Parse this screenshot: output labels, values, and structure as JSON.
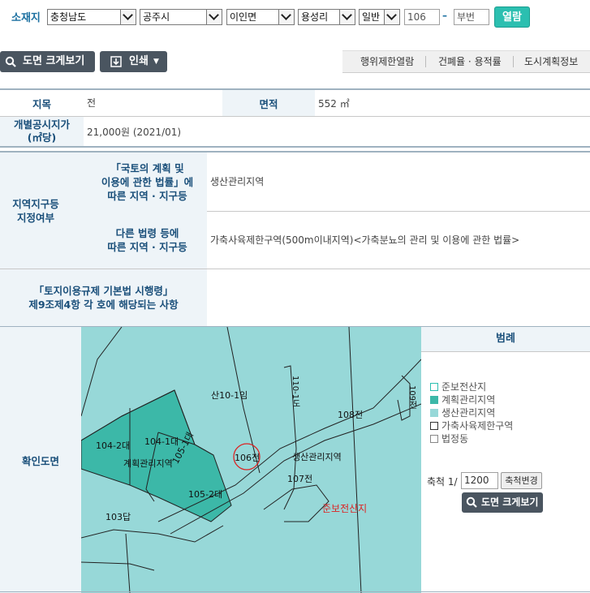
{
  "search": {
    "location_label": "소재지",
    "province": "충청남도",
    "city": "공주시",
    "town": "이인면",
    "village": "용성리",
    "land_type": "일반",
    "main_number": "106",
    "sub_placeholder": "부번",
    "open_button": "열람"
  },
  "toolbar": {
    "enlarge_label": "도면 크게보기",
    "print_label": "인쇄",
    "tabs": [
      "행위제한열람",
      "건폐율 · 용적률",
      "도시계획정보"
    ]
  },
  "info": {
    "land_category_label": "지목",
    "land_category_value": "전",
    "area_label": "면적",
    "area_value": "552 ㎡",
    "price_label_line1": "개별공시지가",
    "price_label_line2": "(㎡당)",
    "price_value": "21,000원 (2021/01)"
  },
  "zoning": {
    "section_label_line1": "지역지구등",
    "section_label_line2": "지정여부",
    "national_law_line1": "「국토의 계획 및",
    "national_law_line2": "이용에 관한 법률」에",
    "national_law_line3": "따른 지역 · 지구등",
    "national_law_value": "생산관리지역",
    "other_law_line1": "다른 법령 등에",
    "other_law_line2": "따른 지역 · 지구등",
    "other_law_value": "가축사육제한구역(500m이내지역)<가축분뇨의 관리 및 이용에 관한 법률>",
    "decree_line1": "「토지이용규제 기본법 시행령」",
    "decree_line2": "제9조제4항 각 호에 해당되는 사항",
    "decree_value": ""
  },
  "map_section": {
    "label": "확인도면",
    "labels": {
      "san10": "산10-1임",
      "n108": "108전",
      "n109": "109전",
      "n110": "110-1도",
      "n104_2": "104-2대",
      "n104_1": "104-1대",
      "n105_1": "105-1대",
      "n105_2": "105-2대",
      "n106": "106전",
      "n107": "107전",
      "n103": "103답",
      "plan_zone": "계획관리지역",
      "prod_zone": "생산관리지역",
      "forest_zone": "준보전산지"
    }
  },
  "legend": {
    "title": "범례",
    "items": [
      {
        "label": "준보전산지",
        "color": "#ffffff",
        "border": "#2bbfb0"
      },
      {
        "label": "계획관리지역",
        "color": "#3cb8a8",
        "border": "#3cb8a8"
      },
      {
        "label": "생산관리지역",
        "color": "#97d8d8",
        "border": "#97d8d8"
      },
      {
        "label": "가축사육제한구역",
        "color": "#ffffff",
        "border": "#333333"
      },
      {
        "label": "법정동",
        "color": "#ffffff",
        "border": "#888888"
      }
    ],
    "scale_label": "축척 1/",
    "scale_value": "1200",
    "scale_change_button": "축척변경",
    "enlarge_button": "도면 크게보기"
  },
  "colors": {
    "accent": "#2bbfb0",
    "header_text": "#1a4f7a",
    "plan_zone": "#3cb8a8",
    "prod_zone": "#97d8d8",
    "dark_button": "#4a5560"
  }
}
